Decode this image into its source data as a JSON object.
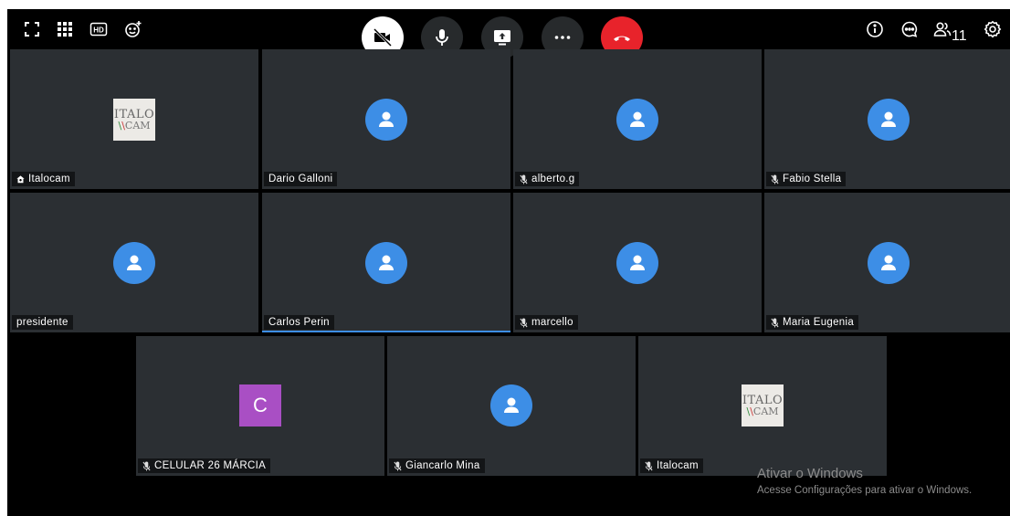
{
  "toolbar": {
    "left_icons": [
      "fullscreen-icon",
      "tile-view-icon",
      "hd-quality-icon",
      "reactions-icon"
    ],
    "controls": [
      "camera-off",
      "microphone",
      "screen-share",
      "more",
      "hang-up"
    ],
    "right_icons": [
      "info-icon",
      "chat-icon",
      "participants-icon",
      "settings-icon"
    ],
    "participant_count": "11",
    "hd_label": "HD"
  },
  "colors": {
    "avatar_blue": "#3d8ee6",
    "hangup_red": "#e8232b",
    "tile_bg": "#2b2f33",
    "letter_avatar": "#a94fc4"
  },
  "participants": [
    {
      "name": "Italocam",
      "icon": "moderator-icon",
      "avatar": "logo"
    },
    {
      "name": "Dario Galloni",
      "icon": "",
      "avatar": "user"
    },
    {
      "name": "alberto.g",
      "icon": "mic-muted-icon",
      "avatar": "user"
    },
    {
      "name": "Fabio Stella",
      "icon": "mic-muted-icon",
      "avatar": "user"
    },
    {
      "name": "presidente",
      "icon": "",
      "avatar": "user"
    },
    {
      "name": "Carlos Perin",
      "icon": "",
      "avatar": "user",
      "speaking": true
    },
    {
      "name": "marcello",
      "icon": "mic-muted-icon",
      "avatar": "user"
    },
    {
      "name": "Maria Eugenia",
      "icon": "mic-muted-icon",
      "avatar": "user"
    },
    {
      "name": "CELULAR 26 MÁRCIA",
      "icon": "mic-muted-icon",
      "avatar": "letter",
      "letter": "C"
    },
    {
      "name": "Giancarlo Mina",
      "icon": "mic-muted-icon",
      "avatar": "user"
    },
    {
      "name": "Italocam",
      "icon": "mic-muted-icon",
      "avatar": "logo"
    }
  ],
  "logo": {
    "line1": "ITALO",
    "line2": "CAM"
  },
  "watermark": {
    "title": "Ativar o Windows",
    "subtitle": "Acesse Configurações para ativar o Windows."
  }
}
